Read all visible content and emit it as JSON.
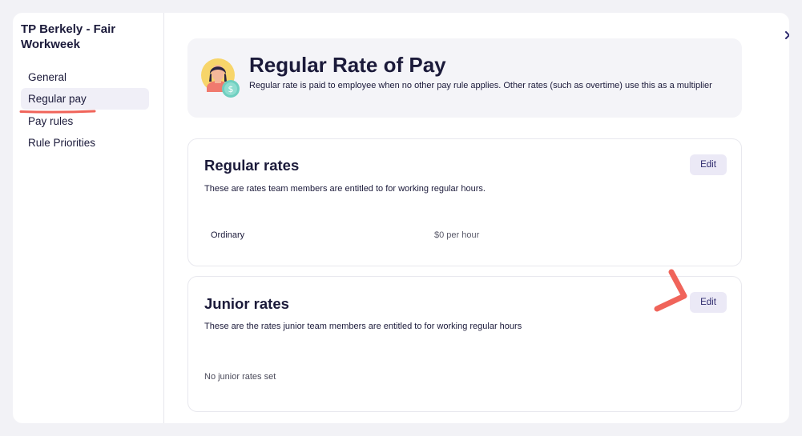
{
  "sidebar": {
    "title": "TP Berkely - Fair Workweek",
    "items": [
      {
        "label": "General"
      },
      {
        "label": "Regular pay"
      },
      {
        "label": "Pay rules"
      },
      {
        "label": "Rule Priorities"
      }
    ],
    "active_item": "Regular pay"
  },
  "header": {
    "title": "Regular Rate of Pay",
    "description": "Regular rate is paid to employee when no other pay rule applies. Other rates (such as overtime) use this as a multiplier",
    "avatar_icon": "employee-avatar-icon",
    "badge_icon": "dollar-badge-icon"
  },
  "regular_rates": {
    "title": "Regular rates",
    "description": "These are rates team members are entitled to for working regular hours.",
    "edit_label": "Edit",
    "rows": [
      {
        "name": "Ordinary",
        "value": "$0 per hour"
      }
    ]
  },
  "junior_rates": {
    "title": "Junior rates",
    "description": "These are the rates junior team members are entitled to for working regular hours",
    "edit_label": "Edit",
    "empty_text": "No junior rates set"
  },
  "close_icon": "close-icon",
  "colors": {
    "accent": "#2e2a6e",
    "highlight": "#f0645a",
    "background": "#f2f2f6",
    "active_nav_bg": "#f0eff7",
    "edit_button_bg": "#ebe9f6"
  }
}
